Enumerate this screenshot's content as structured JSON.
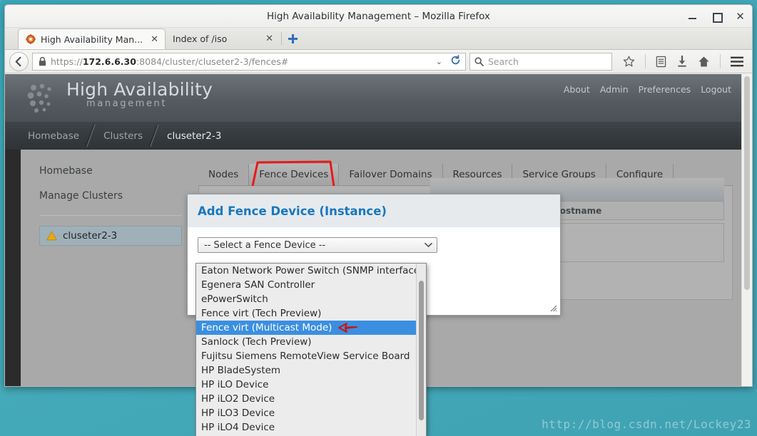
{
  "window": {
    "title": "High Availability Management – Mozilla Firefox",
    "minimize_label": "Minimize",
    "maximize_label": "Maximize",
    "close_label": "Close"
  },
  "browser": {
    "tabs": [
      {
        "label": "High Availability Man...",
        "close": "✕",
        "favicon": "gear-favicon",
        "active": true
      },
      {
        "label": "Index of /iso",
        "close": "✕",
        "favicon": "none",
        "active": false
      }
    ],
    "new_tab_label": "+",
    "url": {
      "scheme": "https://",
      "host": "172.6.6.30",
      "path": ":8084/cluster/cluseter2-3/fences#",
      "full": "https://172.6.6.30:8084/cluster/cluseter2-3/fences#",
      "dropmarker": "⌄"
    },
    "search": {
      "placeholder": "Search",
      "value": ""
    },
    "toolbar_icons": [
      "bookmark-star-icon",
      "reader-list-icon",
      "downloads-icon",
      "home-icon",
      "menu-icon"
    ]
  },
  "app": {
    "logo_title": "High Availability",
    "logo_subtitle": "management",
    "header_links": [
      "About",
      "Admin",
      "Preferences",
      "Logout"
    ],
    "breadcrumb": [
      "Homebase",
      "Clusters",
      "cluseter2-3"
    ]
  },
  "sidebar": {
    "links": [
      "Homebase",
      "Manage Clusters"
    ],
    "cluster": {
      "name": "cluseter2-3",
      "status_icon": "warning-triangle-icon"
    }
  },
  "content": {
    "tabs": [
      {
        "label": "Nodes",
        "active": false
      },
      {
        "label": "Fence Devices",
        "active": true
      },
      {
        "label": "Failover Domains",
        "active": false
      },
      {
        "label": "Resources",
        "active": false
      },
      {
        "label": "Service Groups",
        "active": false
      },
      {
        "label": "Configure",
        "active": false
      }
    ],
    "table_header": "Hostname"
  },
  "dialog": {
    "title": "Add Fence Device (Instance)",
    "select": {
      "value": "-- Select a Fence Device --",
      "expanded": true,
      "selected_option": "Fence virt (Multicast Mode)",
      "options": [
        "Eaton Network Power Switch (SNMP interface)",
        "Egenera SAN Controller",
        "ePowerSwitch",
        "Fence virt (Tech Preview)",
        "Fence virt (Multicast Mode)",
        "Sanlock (Tech Preview)",
        "Fujitsu Siemens RemoteView Service Board",
        "HP BladeSystem",
        "HP iLO Device",
        "HP iLO2 Device",
        "HP iLO3 Device",
        "HP iLO4 Device"
      ]
    }
  },
  "annotations": {
    "tab_highlight_color": "#e8191b",
    "arrow_color": "#cc1414",
    "arrow_target": "Fence virt (Multicast Mode)"
  },
  "watermark": {
    "text": "http://blog.csdn.net/Lockey23"
  },
  "colors": {
    "desktop": "#3ba5b8",
    "app_header": "#555b61",
    "breadcrumb": "#33373b",
    "dialog_title": "#1878be",
    "select_highlight": "#3b8fe0",
    "cluster_item": "#9fb0b8"
  }
}
